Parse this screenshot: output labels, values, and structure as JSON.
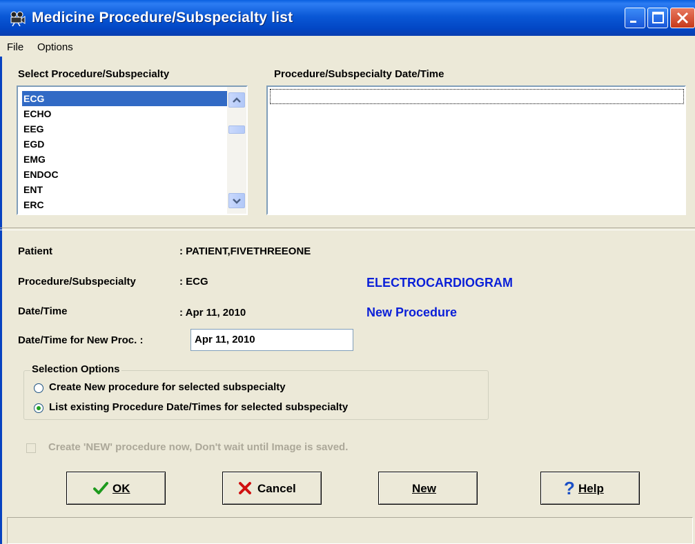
{
  "window": {
    "title": "Medicine Procedure/Subspecialty list",
    "title_icon": "movie-camera-icon",
    "controls": [
      "minimize",
      "maximize",
      "close"
    ]
  },
  "menu": [
    "File",
    "Options"
  ],
  "procedure_list": {
    "heading": "Select Procedure/Subspecialty",
    "items": [
      "ECG",
      "ECHO",
      "EEG",
      "EGD",
      "EMG",
      "ENDOC",
      "ENT",
      "ERC"
    ],
    "selected": "ECG"
  },
  "date_list": {
    "heading": "Procedure/Subspecialty Date/Time"
  },
  "details": {
    "patient_label": "Patient",
    "patient_value": ": PATIENT,FIVETHREEONE",
    "procedure_label": "Procedure/Subspecialty",
    "procedure_value": ": ECG",
    "procedure_full_name": "ELECTROCARDIOGRAM",
    "datetime_label": "Date/Time",
    "datetime_value": ": Apr 11, 2010",
    "datetime_status": "New Procedure",
    "new_proc_label": "Date/Time for New Proc. :",
    "new_proc_value": "Apr 11, 2010"
  },
  "selection_options": {
    "legend": "Selection Options",
    "options": [
      {
        "label": "Create New procedure for selected subspecialty",
        "checked": false
      },
      {
        "label": "List existing Procedure Date/Times for selected subspecialty",
        "checked": true
      }
    ]
  },
  "create_now_checkbox": {
    "label": "Create 'NEW' procedure now, Don't wait until Image is saved.",
    "checked": false,
    "enabled": false
  },
  "buttons": {
    "ok": "OK",
    "cancel": "Cancel",
    "new": "New",
    "help": "Help"
  },
  "colors": {
    "title_bar": "#0a58d6",
    "selection": "#316ac5",
    "accent_text": "#0a1fd8",
    "window_bg": "#ece9d8"
  }
}
